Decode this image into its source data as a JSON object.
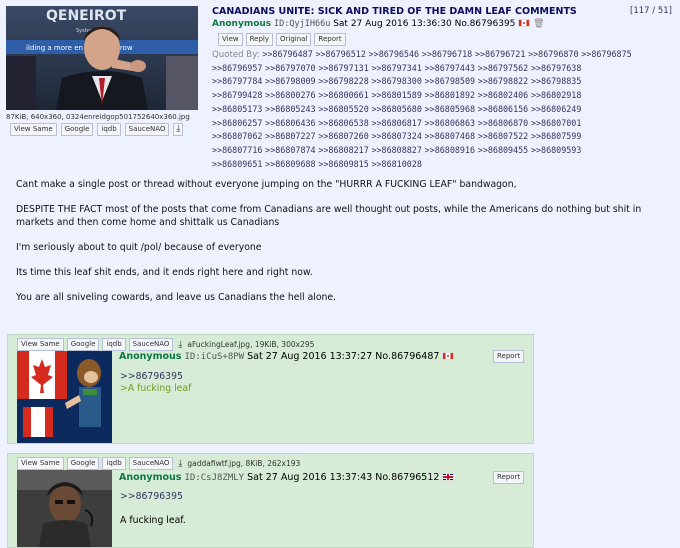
{
  "op": {
    "subject": "CANADIANS UNITE: SICK AND TIRED OF THE DAMN LEAF COMMENTS",
    "counter": "[117 / 51]",
    "name": "Anonymous",
    "id": "ID:QyjIH66u",
    "datetime": "Sat 27 Aug 2016 13:36:30",
    "number": "No.86796395",
    "buttons": [
      "View",
      "Reply",
      "Original",
      "Report"
    ],
    "quoted_by_label": "Quoted By:",
    "quoted_by": [
      ">>86796487",
      ">>86796512",
      ">>86796546",
      ">>86796718",
      ">>86796721",
      ">>86796870",
      ">>86796875",
      ">>86796957",
      ">>86797070",
      ">>86797131",
      ">>86797341",
      ">>86797443",
      ">>86797562",
      ">>86797638",
      ">>86797784",
      ">>86798009",
      ">>86798228",
      ">>86798300",
      ">>86798509",
      ">>86798822",
      ">>86798835",
      ">>86799428",
      ">>86800276",
      ">>86800661",
      ">>86801589",
      ">>86801892",
      ">>86802406",
      ">>86802918",
      ">>86805173",
      ">>86805243",
      ">>86805520",
      ">>86805680",
      ">>86805968",
      ">>86806156",
      ">>86806249",
      ">>86806257",
      ">>86806436",
      ">>86806538",
      ">>86806817",
      ">>86806863",
      ">>86806870",
      ">>86807001",
      ">>86807062",
      ">>86807227",
      ">>86807260",
      ">>86807324",
      ">>86807468",
      ">>86807522",
      ">>86807599",
      ">>86807716",
      ">>86807874",
      ">>86808217",
      ">>86808827",
      ">>86808916",
      ">>86809455",
      ">>86809593",
      ">>86809651",
      ">>86809688",
      ">>86809815",
      ">>86810028"
    ],
    "file_info": "87KiB, 640x360, 0324enreidgop501752640x360.jpg",
    "file_buttons": [
      "View Same",
      "Google",
      "iqdb",
      "SauceNAO"
    ],
    "image_banner_text": "QENEIROT",
    "image_bg_text": "Systems",
    "image_sign_text": "ilding a more en       ent tomorrow",
    "body": [
      "Cant make a single post or thread without everyone jumping on the \"HURRR A FUCKING LEAF\" bandwagon,",
      "DESPITE THE FACT most of the posts that come from Canadians are well thought out posts, while the Americans do nothing but shit in markets and then come home and shittalk us Canadians",
      "I'm seriously about to quit /pol/ because of everyone",
      "Its time this leaf shit ends, and it ends right here and right now.",
      "You are all sniveling cowards, and leave us Canadians the hell alone."
    ],
    "flag_color": "#d52b1e"
  },
  "replies": [
    {
      "file_buttons": [
        "View Same",
        "Google",
        "iqdb",
        "SauceNAO"
      ],
      "file_info": "aFuckingLeaf.jpg, 19KiB, 300x295",
      "name": "Anonymous",
      "id": "ID:iCuS+8PW",
      "datetime": "Sat 27 Aug 2016 13:37:27",
      "number": "No.86796487",
      "flag": "canada-flag",
      "report": "Report",
      "quote_link": ">>86796395",
      "greentext": ">A fucking leaf"
    },
    {
      "file_buttons": [
        "View Same",
        "Google",
        "iqdb",
        "SauceNAO"
      ],
      "file_info": "gaddafiwtf.jpg, 8KiB, 262x193",
      "name": "Anonymous",
      "id": "ID:CsJ8ZMLY",
      "datetime": "Sat 27 Aug 2016 13:37:43",
      "number": "No.86796512",
      "flag": "uk-flag",
      "report": "Report",
      "quote_link": ">>86796395",
      "text": "A fucking leaf."
    }
  ],
  "colors": {
    "page_bg": "#eef2ff",
    "subject": "#0f0c5d",
    "name": "#117743",
    "reply_bg": "#d6ecd6",
    "greentext": "#789922",
    "link": "#34345c"
  },
  "icons": [
    "download-icon",
    "trash-icon",
    "canada-flag",
    "uk-flag"
  ]
}
